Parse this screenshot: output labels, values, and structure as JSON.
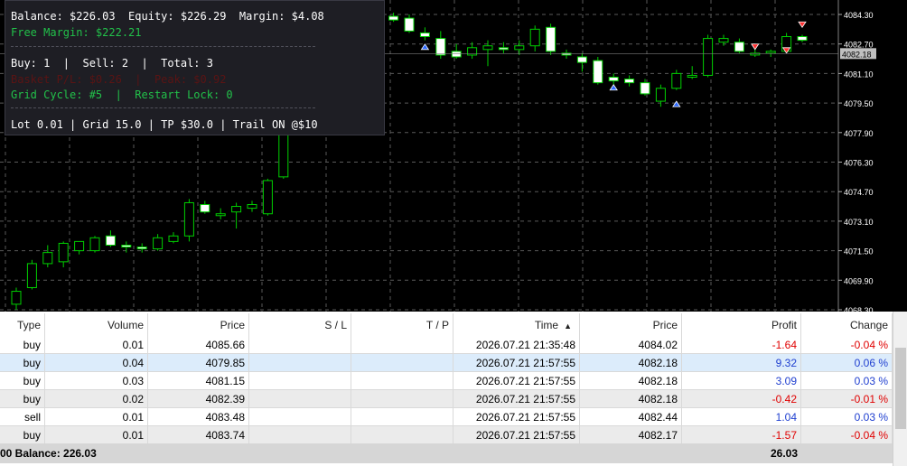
{
  "info_panel": {
    "balance_line": "Balance: $226.03  Equity: $226.29  Margin: $4.08",
    "free_margin_line": "Free Margin: $222.21",
    "positions_line": "Buy: 1  |  Sell: 2  |  Total: 3",
    "basket_line": "Basket P/L: $0.26  |  Peak: $0.92",
    "grid_line": "Grid Cycle: #5  |  Restart Lock: 0",
    "settings_line": "Lot 0.01 | Grid 15.0 | TP $30.0 | Trail ON @$10"
  },
  "price_axis": {
    "labels": [
      "4084.30",
      "4082.70",
      "4081.10",
      "4079.50",
      "4077.90",
      "4076.30",
      "4074.70",
      "4073.10",
      "4071.50",
      "4069.90",
      "4068.30"
    ],
    "current_price": "4082.18"
  },
  "chart_candles": [
    {
      "o": 4068.6,
      "h": 4069.5,
      "l": 4068.3,
      "c": 4069.3
    },
    {
      "o": 4069.5,
      "h": 4071.0,
      "l": 4069.4,
      "c": 4070.8
    },
    {
      "o": 4070.8,
      "h": 4071.8,
      "l": 4070.6,
      "c": 4071.4
    },
    {
      "o": 4070.9,
      "h": 4072.0,
      "l": 4070.6,
      "c": 4071.9
    },
    {
      "o": 4071.5,
      "h": 4072.0,
      "l": 4071.3,
      "c": 4072.0
    },
    {
      "o": 4071.5,
      "h": 4072.3,
      "l": 4071.4,
      "c": 4072.2
    },
    {
      "o": 4072.3,
      "h": 4072.6,
      "l": 4071.7,
      "c": 4071.8
    },
    {
      "o": 4071.8,
      "h": 4072.0,
      "l": 4071.4,
      "c": 4071.7
    },
    {
      "o": 4071.7,
      "h": 4071.9,
      "l": 4071.4,
      "c": 4071.6
    },
    {
      "o": 4071.6,
      "h": 4072.4,
      "l": 4071.5,
      "c": 4072.2
    },
    {
      "o": 4072.0,
      "h": 4072.5,
      "l": 4071.9,
      "c": 4072.3
    },
    {
      "o": 4072.3,
      "h": 4074.3,
      "l": 4072.0,
      "c": 4074.1
    },
    {
      "o": 4074.0,
      "h": 4074.2,
      "l": 4073.5,
      "c": 4073.6
    },
    {
      "o": 4073.4,
      "h": 4073.8,
      "l": 4073.2,
      "c": 4073.5
    },
    {
      "o": 4073.6,
      "h": 4074.1,
      "l": 4072.7,
      "c": 4073.9
    },
    {
      "o": 4073.8,
      "h": 4074.2,
      "l": 4073.6,
      "c": 4074.0
    },
    {
      "o": 4073.5,
      "h": 4075.4,
      "l": 4073.4,
      "c": 4075.3
    },
    {
      "o": 4075.5,
      "h": 4078.5,
      "l": 4075.4,
      "c": 4078.4
    },
    {
      "o": 4078.8,
      "h": 4081.5,
      "l": 4078.5,
      "c": 4081.3
    },
    {
      "o": 4081.2,
      "h": 4081.8,
      "l": 4080.6,
      "c": 4081.7
    },
    {
      "o": 4082.1,
      "h": 4082.4,
      "l": 4081.6,
      "c": 4082.3
    },
    {
      "o": 4082.5,
      "h": 4085.0,
      "l": 4082.3,
      "c": 4084.5
    },
    {
      "o": 4084.5,
      "h": 4085.2,
      "l": 4083.9,
      "c": 4084.8
    },
    {
      "o": 4085.1,
      "h": 4085.6,
      "l": 4084.4,
      "c": 4085.4
    },
    {
      "o": 4084.2,
      "h": 4084.4,
      "l": 4083.9,
      "c": 4084.0
    },
    {
      "o": 4084.1,
      "h": 4084.3,
      "l": 4083.3,
      "c": 4083.4
    },
    {
      "o": 4083.3,
      "h": 4083.6,
      "l": 4082.9,
      "c": 4083.1
    },
    {
      "o": 4083.0,
      "h": 4083.4,
      "l": 4081.9,
      "c": 4082.1
    },
    {
      "o": 4082.3,
      "h": 4082.7,
      "l": 4081.9,
      "c": 4082.0
    },
    {
      "o": 4082.1,
      "h": 4082.8,
      "l": 4081.9,
      "c": 4082.5
    },
    {
      "o": 4082.4,
      "h": 4082.9,
      "l": 4081.5,
      "c": 4082.6
    },
    {
      "o": 4082.5,
      "h": 4082.8,
      "l": 4082.2,
      "c": 4082.4
    },
    {
      "o": 4082.4,
      "h": 4082.9,
      "l": 4082.1,
      "c": 4082.6
    },
    {
      "o": 4082.6,
      "h": 4083.7,
      "l": 4082.3,
      "c": 4083.5
    },
    {
      "o": 4083.6,
      "h": 4083.8,
      "l": 4082.1,
      "c": 4082.3
    },
    {
      "o": 4082.2,
      "h": 4082.4,
      "l": 4081.9,
      "c": 4082.1
    },
    {
      "o": 4082.0,
      "h": 4082.2,
      "l": 4081.2,
      "c": 4081.7
    },
    {
      "o": 4081.8,
      "h": 4082.0,
      "l": 4080.5,
      "c": 4080.6
    },
    {
      "o": 4080.9,
      "h": 4081.1,
      "l": 4080.5,
      "c": 4080.7
    },
    {
      "o": 4080.8,
      "h": 4081.0,
      "l": 4080.4,
      "c": 4080.6
    },
    {
      "o": 4080.6,
      "h": 4080.8,
      "l": 4079.9,
      "c": 4080.0
    },
    {
      "o": 4079.6,
      "h": 4080.5,
      "l": 4079.3,
      "c": 4080.3
    },
    {
      "o": 4080.3,
      "h": 4081.3,
      "l": 4080.2,
      "c": 4081.1
    },
    {
      "o": 4080.9,
      "h": 4081.5,
      "l": 4080.8,
      "c": 4081.0
    },
    {
      "o": 4081.0,
      "h": 4083.2,
      "l": 4080.9,
      "c": 4083.0
    },
    {
      "o": 4082.8,
      "h": 4083.2,
      "l": 4082.6,
      "c": 4083.0
    },
    {
      "o": 4082.8,
      "h": 4083.0,
      "l": 4082.2,
      "c": 4082.3
    },
    {
      "o": 4082.2,
      "h": 4082.7,
      "l": 4082.0,
      "c": 4082.2
    },
    {
      "o": 4082.2,
      "h": 4082.4,
      "l": 4082.0,
      "c": 4082.3
    },
    {
      "o": 4082.3,
      "h": 4083.3,
      "l": 4082.2,
      "c": 4083.1
    },
    {
      "o": 4083.1,
      "h": 4083.2,
      "l": 4082.8,
      "c": 4082.9
    }
  ],
  "chart_markers": [
    {
      "candle": 23,
      "price": 4084.7,
      "kind": "sell"
    },
    {
      "candle": 23,
      "price": 4084.3,
      "kind": "buy"
    },
    {
      "candle": 26,
      "price": 4082.5,
      "kind": "buy"
    },
    {
      "candle": 38,
      "price": 4080.3,
      "kind": "buy"
    },
    {
      "candle": 42,
      "price": 4079.4,
      "kind": "buy"
    },
    {
      "candle": 47,
      "price": 4082.6,
      "kind": "sell"
    },
    {
      "candle": 49,
      "price": 4082.4,
      "kind": "sell"
    },
    {
      "candle": 50,
      "price": 4083.8,
      "kind": "sell"
    }
  ],
  "table": {
    "headers": {
      "type": "Type",
      "volume": "Volume",
      "price": "Price",
      "sl": "S / L",
      "tp": "T / P",
      "time": "Time",
      "cur_price": "Price",
      "profit": "Profit",
      "change": "Change"
    },
    "sort_indicator": "▲",
    "rows": [
      {
        "type": "buy",
        "volume": "0.01",
        "price": "4085.66",
        "sl": "",
        "tp": "",
        "time": "2026.07.21 21:35:48",
        "cur_price": "4084.02",
        "profit": "-1.64",
        "change": "-0.04 %"
      },
      {
        "type": "buy",
        "volume": "0.04",
        "price": "4079.85",
        "sl": "",
        "tp": "",
        "time": "2026.07.21 21:57:55",
        "cur_price": "4082.18",
        "profit": "9.32",
        "change": "0.06 %"
      },
      {
        "type": "buy",
        "volume": "0.03",
        "price": "4081.15",
        "sl": "",
        "tp": "",
        "time": "2026.07.21 21:57:55",
        "cur_price": "4082.18",
        "profit": "3.09",
        "change": "0.03 %"
      },
      {
        "type": "buy",
        "volume": "0.02",
        "price": "4082.39",
        "sl": "",
        "tp": "",
        "time": "2026.07.21 21:57:55",
        "cur_price": "4082.18",
        "profit": "-0.42",
        "change": "-0.01 %"
      },
      {
        "type": "sell",
        "volume": "0.01",
        "price": "4083.48",
        "sl": "",
        "tp": "",
        "time": "2026.07.21 21:57:55",
        "cur_price": "4082.44",
        "profit": "1.04",
        "change": "0.03 %"
      },
      {
        "type": "buy",
        "volume": "0.01",
        "price": "4083.74",
        "sl": "",
        "tp": "",
        "time": "2026.07.21 21:57:55",
        "cur_price": "4082.17",
        "profit": "-1.57",
        "change": "-0.04 %"
      }
    ],
    "footer": {
      "balance": "00  Balance: 226.03",
      "total_profit": "26.03"
    }
  },
  "colors": {
    "chart_bg": "#000000",
    "grid": "#5a5a5a",
    "bull_body": "#000000",
    "bull_border": "#00d000",
    "bear_body": "#ffffff",
    "candle_wick": "#00d000",
    "negative": "#e00000",
    "positive": "#1f3fd0",
    "selected_row": "#dcecfb"
  }
}
